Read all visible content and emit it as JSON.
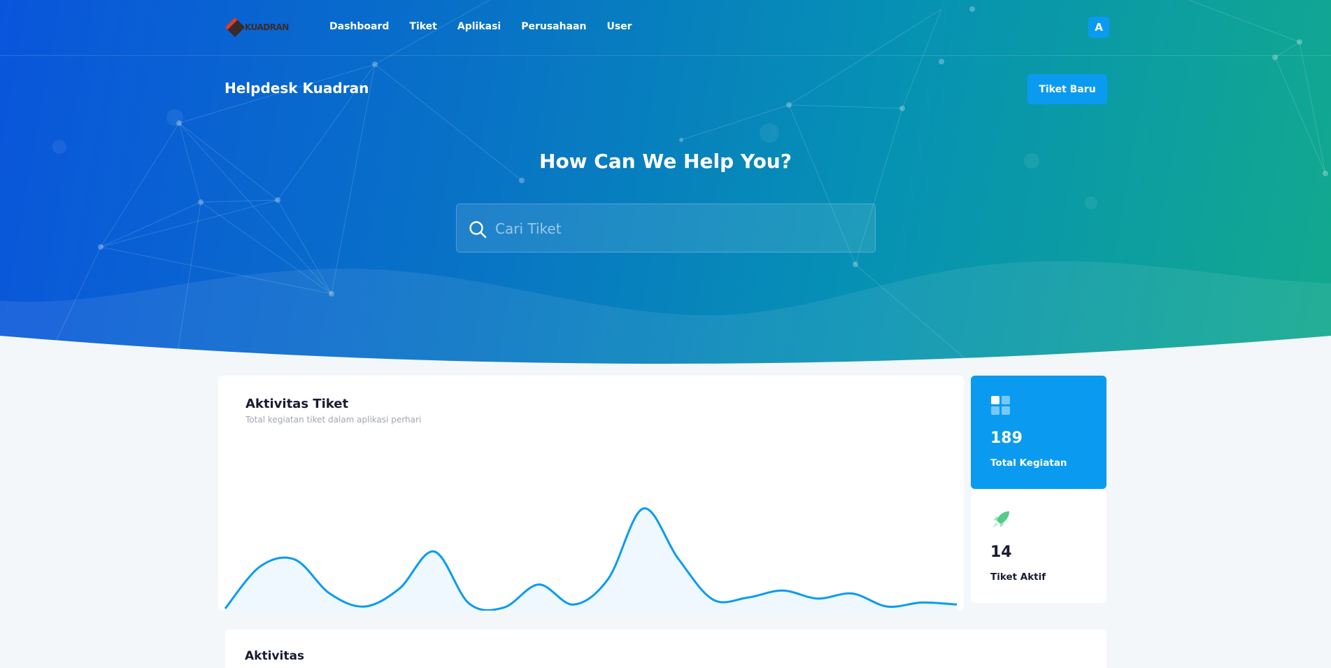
{
  "header": {
    "logo_text": "KUADRAN",
    "nav": [
      "Dashboard",
      "Tiket",
      "Aplikasi",
      "Perusahaan",
      "User"
    ],
    "avatar_initial": "A"
  },
  "toolbar": {
    "page_title": "Helpdesk Kuadran",
    "new_ticket_label": "Tiket Baru"
  },
  "hero": {
    "heading": "How Can We Help You?",
    "search_placeholder": "Cari Tiket"
  },
  "activity_chart": {
    "title": "Aktivitas Tiket",
    "subtitle": "Total kegiatan tiket dalam aplikasi perhari"
  },
  "chart_data": {
    "type": "area",
    "values": [
      0,
      42,
      49,
      15,
      2,
      20,
      57,
      5,
      1,
      24,
      4,
      30,
      100,
      50,
      9,
      11,
      18,
      10,
      15,
      2,
      6,
      4
    ],
    "ylim": [
      0,
      100
    ],
    "grid": false,
    "color": "#0a9bf0"
  },
  "stats": [
    {
      "value": "189",
      "label": "Total Kegiatan",
      "icon": "grid-icon"
    },
    {
      "value": "14",
      "label": "Tiket Aktif",
      "icon": "rocket-icon"
    }
  ],
  "activity_section": {
    "title": "Aktivitas"
  }
}
